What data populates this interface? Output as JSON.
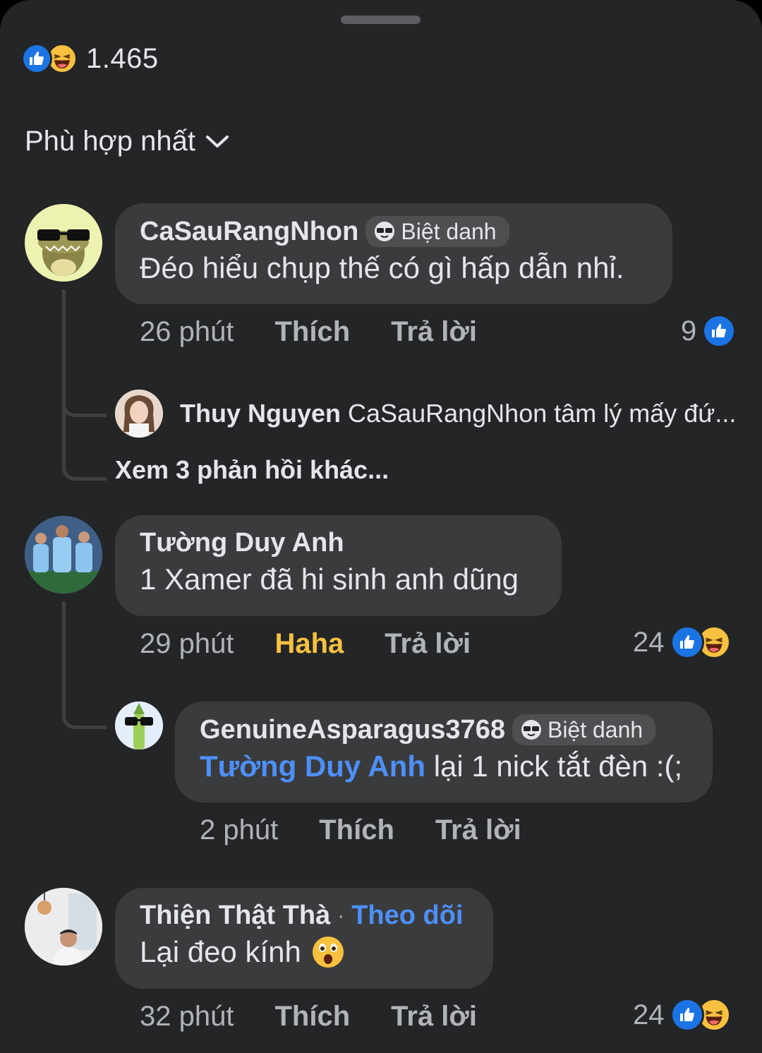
{
  "post": {
    "reaction_total": "1.465"
  },
  "sort": {
    "label": "Phù hợp nhất"
  },
  "comments": [
    {
      "author": "CaSauRangNhon",
      "badge": "Biệt danh",
      "text": "Đéo hiểu chụp thế có gì hấp dẫn nhỉ.",
      "time": "26 phút",
      "like_label": "Thích",
      "reply_label": "Trả lời",
      "reaction_count": "9",
      "reply_preview": {
        "author": "Thuy Nguyen",
        "text": "CaSauRangNhon tâm lý mấy đứ..."
      },
      "more_replies": "Xem 3 phản hồi khác..."
    },
    {
      "author": "Tường Duy Anh",
      "text": "1 Xamer đã hi sinh anh dũng",
      "time": "29 phút",
      "like_label": "Haha",
      "reply_label": "Trả lời",
      "reaction_count": "24",
      "replies": [
        {
          "author": "GenuineAsparagus3768",
          "badge": "Biệt danh",
          "mention": "Tường Duy Anh",
          "text": "lại 1 nick tắt đèn :(;",
          "time": "2 phút",
          "like_label": "Thích",
          "reply_label": "Trả lời"
        }
      ]
    },
    {
      "author": "Thiện Thật Thà",
      "separator": "·",
      "follow_label": "Theo dõi",
      "text": "Lại đeo kính",
      "time": "32 phút",
      "like_label": "Thích",
      "reply_label": "Trả lời",
      "reaction_count": "24"
    }
  ],
  "colors": {
    "background": "#242526",
    "bubble": "#3a3b3c",
    "link": "#4d8ff7",
    "haha": "#f7c13f",
    "like": "#1b74e4"
  }
}
